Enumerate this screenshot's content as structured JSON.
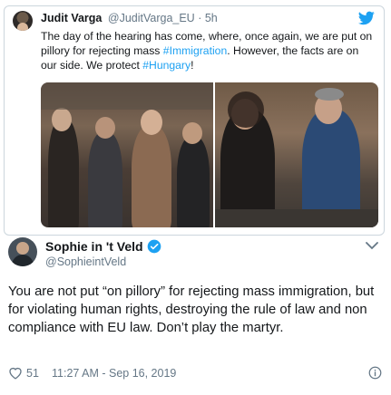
{
  "colors": {
    "link": "#1da1f2",
    "muted": "#657786",
    "text": "#14171a",
    "border": "#ccd6dd"
  },
  "quoted_tweet": {
    "name": "Judit Varga",
    "handle": "@JuditVarga_EU",
    "separator": "·",
    "time": "5h",
    "text_parts": {
      "p1": "The day of the hearing has come, where, once again, we are put on pillory for rejecting mass ",
      "tag1": "#Immigration",
      "p2": ". However, the facts are on our side. We protect ",
      "tag2": "#Hungary",
      "p3": "!"
    },
    "icons": {
      "bird": "twitter-bird-icon",
      "avatar": "avatar"
    }
  },
  "author": {
    "name": "Sophie in 't Veld",
    "handle": "@SophieintVeld",
    "icons": {
      "verified": "verified-badge-icon",
      "menu": "chevron-down-icon"
    }
  },
  "tweet_text": "You are not put “on pillory” for rejecting mass immigration, but for violating human rights, destroying the rule of law and non compliance with EU law. Don’t play the martyr.",
  "footer": {
    "likes": "51",
    "timestamp": "11:27 AM - Sep 16, 2019",
    "icons": {
      "like": "heart-icon",
      "info": "info-icon"
    }
  }
}
